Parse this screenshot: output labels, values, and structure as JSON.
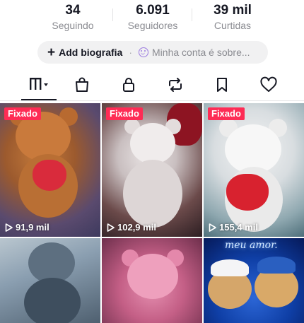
{
  "profile": {
    "stats": [
      {
        "value": "34",
        "label": "Seguindo"
      },
      {
        "value": "6.091",
        "label": "Seguidores"
      },
      {
        "value": "39 mil",
        "label": "Curtidas"
      }
    ],
    "bio": {
      "add_label": "Add biografia",
      "separator": "·",
      "account_label": "Minha conta é sobre..."
    }
  },
  "tabs": [
    {
      "icon": "grid-icon",
      "active": true
    },
    {
      "icon": "shopping-bag-icon",
      "active": false
    },
    {
      "icon": "lock-icon",
      "active": false
    },
    {
      "icon": "repost-icon",
      "active": false
    },
    {
      "icon": "bookmark-icon",
      "active": false
    },
    {
      "icon": "heart-icon",
      "active": false
    }
  ],
  "videos": [
    {
      "pinned_label": "Fixado",
      "views": "91,9 mil"
    },
    {
      "pinned_label": "Fixado",
      "views": "102,9 mil"
    },
    {
      "pinned_label": "Fixado",
      "views": "155,4 mil"
    },
    {
      "pinned_label": "",
      "views": ""
    },
    {
      "pinned_label": "",
      "views": ""
    },
    {
      "pinned_label": "",
      "views": ""
    }
  ],
  "overlay_text": {
    "neon_caption": "meu amor."
  },
  "colors": {
    "pinned_badge": "#fe2c55",
    "primary_text": "#161823",
    "secondary_text": "#8a8b91",
    "pill_bg": "#f1f1f2"
  }
}
